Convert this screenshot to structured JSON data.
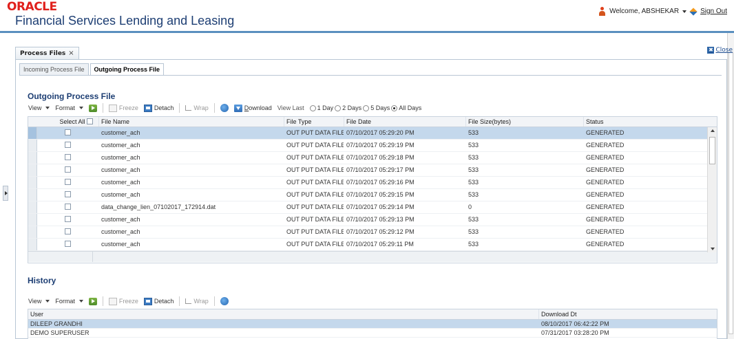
{
  "header": {
    "logo": "ORACLE",
    "app_title": "Financial Services Lending and Leasing",
    "welcome": "Welcome, ABSHEKAR",
    "sign_out": "Sign Out"
  },
  "doc_tab": {
    "label": "Process Files",
    "close_glyph": "×"
  },
  "close_link": {
    "label": "Close",
    "icon_glyph": "✖"
  },
  "subtabs": [
    {
      "label": "Incoming Process File",
      "active": false
    },
    {
      "label": "Outgoing Process File",
      "active": true
    }
  ],
  "outgoing": {
    "title": "Outgoing Process File",
    "toolbar": {
      "view": "View",
      "format": "Format",
      "freeze": "Freeze",
      "detach": "Detach",
      "wrap": "Wrap",
      "download": "Download",
      "view_last": "View Last",
      "options": [
        "1 Day",
        "2 Days",
        "5 Days",
        "All Days"
      ],
      "selected": "All Days"
    },
    "columns": {
      "select_all": "Select All",
      "file_name": "File Name",
      "file_type": "File Type",
      "file_date": "File Date",
      "file_size": "File Size(bytes)",
      "status": "Status"
    },
    "rows": [
      {
        "file_name": "customer_ach",
        "file_type": "OUT PUT DATA FILE",
        "file_date": "07/10/2017 05:29:20 PM",
        "file_size": "533",
        "status": "GENERATED",
        "selected": true
      },
      {
        "file_name": "customer_ach",
        "file_type": "OUT PUT DATA FILE",
        "file_date": "07/10/2017 05:29:19 PM",
        "file_size": "533",
        "status": "GENERATED"
      },
      {
        "file_name": "customer_ach",
        "file_type": "OUT PUT DATA FILE",
        "file_date": "07/10/2017 05:29:18 PM",
        "file_size": "533",
        "status": "GENERATED"
      },
      {
        "file_name": "customer_ach",
        "file_type": "OUT PUT DATA FILE",
        "file_date": "07/10/2017 05:29:17 PM",
        "file_size": "533",
        "status": "GENERATED"
      },
      {
        "file_name": "customer_ach",
        "file_type": "OUT PUT DATA FILE",
        "file_date": "07/10/2017 05:29:16 PM",
        "file_size": "533",
        "status": "GENERATED"
      },
      {
        "file_name": "customer_ach",
        "file_type": "OUT PUT DATA FILE",
        "file_date": "07/10/2017 05:29:15 PM",
        "file_size": "533",
        "status": "GENERATED"
      },
      {
        "file_name": "data_change_lien_07102017_172914.dat",
        "file_type": "OUT PUT DATA FILE",
        "file_date": "07/10/2017 05:29:14 PM",
        "file_size": "0",
        "status": "GENERATED"
      },
      {
        "file_name": "customer_ach",
        "file_type": "OUT PUT DATA FILE",
        "file_date": "07/10/2017 05:29:13 PM",
        "file_size": "533",
        "status": "GENERATED"
      },
      {
        "file_name": "customer_ach",
        "file_type": "OUT PUT DATA FILE",
        "file_date": "07/10/2017 05:29:12 PM",
        "file_size": "533",
        "status": "GENERATED"
      },
      {
        "file_name": "customer_ach",
        "file_type": "OUT PUT DATA FILE",
        "file_date": "07/10/2017 05:29:11 PM",
        "file_size": "533",
        "status": "GENERATED"
      }
    ]
  },
  "history": {
    "title": "History",
    "toolbar": {
      "view": "View",
      "format": "Format",
      "freeze": "Freeze",
      "detach": "Detach",
      "wrap": "Wrap"
    },
    "columns": {
      "user": "User",
      "download_dt": "Download Dt"
    },
    "rows": [
      {
        "user": "DILEEP GRANDHI",
        "download_dt": "08/10/2017 06:42:22 PM",
        "selected": true
      },
      {
        "user": "DEMO SUPERUSER",
        "download_dt": "07/31/2017 03:28:20 PM"
      }
    ]
  }
}
